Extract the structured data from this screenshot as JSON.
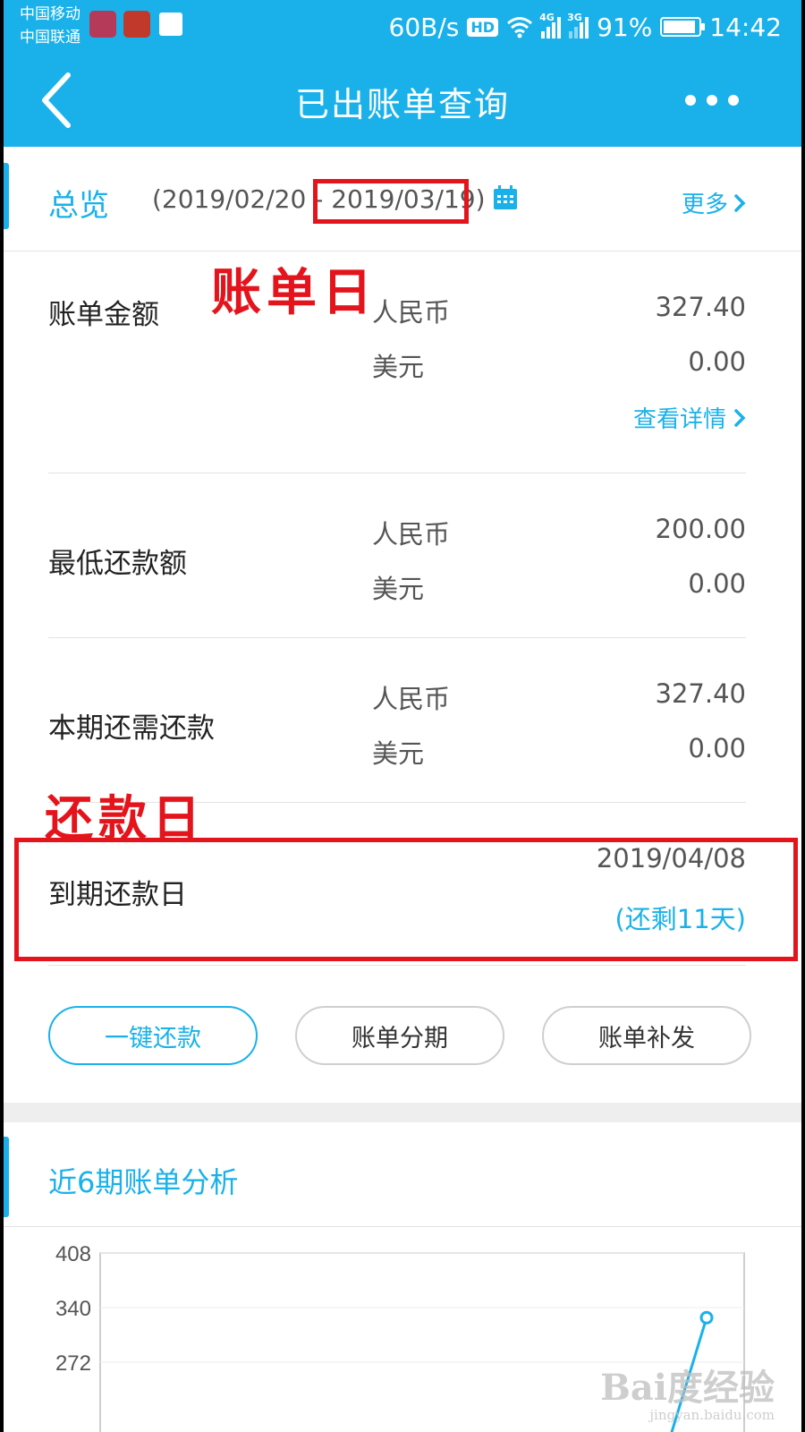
{
  "status_bar": {
    "carrier_1": "中国移动",
    "carrier_2": "中国联通",
    "net_speed": "60B/s",
    "hd_badge": "HD",
    "net_4g": "4G",
    "net_3g": "3G",
    "battery": "91%",
    "battery_level": 0.91,
    "time": "14:42"
  },
  "nav": {
    "title": "已出账单查询"
  },
  "overview": {
    "title": "总览",
    "date_range": "(2019/02/20 - 2019/03/19)",
    "more_label": "更多",
    "rows": [
      {
        "label": "账单金额",
        "lines": [
          {
            "currency": "人民币",
            "amount": "327.40"
          },
          {
            "currency": "美元",
            "amount": "0.00"
          }
        ]
      },
      {
        "label": "最低还款额",
        "lines": [
          {
            "currency": "人民币",
            "amount": "200.00"
          },
          {
            "currency": "美元",
            "amount": "0.00"
          }
        ]
      },
      {
        "label": "本期还需还款",
        "lines": [
          {
            "currency": "人民币",
            "amount": "327.40"
          },
          {
            "currency": "美元",
            "amount": "0.00"
          }
        ]
      }
    ],
    "detail_link": "查看详情",
    "due": {
      "label": "到期还款日",
      "date": "2019/04/08",
      "remaining": "(还剩11天)"
    }
  },
  "annotations": {
    "bill_day": "账单日",
    "repay_day": "还款日"
  },
  "actions": {
    "one_click": "一键还款",
    "installment": "账单分期",
    "reissue": "账单补发"
  },
  "analysis": {
    "title": "近6期账单分析"
  },
  "chart_data": {
    "type": "line",
    "y_ticks": [
      "408",
      "340",
      "272"
    ],
    "ylim": [
      204,
      408
    ],
    "series": [
      {
        "values": [
          327.4
        ]
      }
    ]
  },
  "watermark": {
    "brand": "Bai度经验",
    "url": "jingyan.baidu.com"
  },
  "colors": {
    "accent": "#1ab1ea",
    "annotation_red": "#e4141c"
  }
}
